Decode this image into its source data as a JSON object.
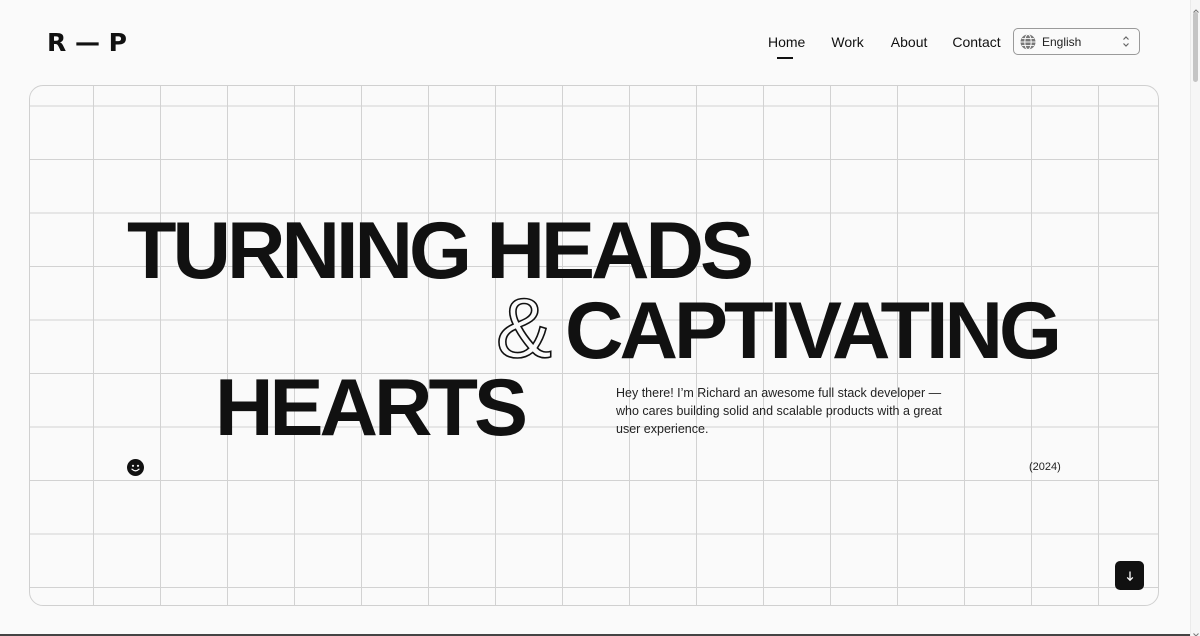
{
  "header": {
    "logo": "R — P",
    "nav": [
      {
        "label": "Home",
        "active": true
      },
      {
        "label": "Work"
      },
      {
        "label": "About"
      },
      {
        "label": "Contact"
      }
    ],
    "language": {
      "selected": "English",
      "icon": "globe-icon"
    }
  },
  "hero": {
    "line1": "TURNING HEADS",
    "ampersand": "&",
    "line2": "CAPTIVATING",
    "line3": "HEARTS",
    "intro": "Hey there! I’m Richard an awesome full stack developer — who cares building solid and scalable products with a great user experience.",
    "year": "(2024)",
    "smiley_icon": "smiley-icon",
    "scroll_icon": "arrow-down-icon"
  },
  "colors": {
    "background": "#fafafa",
    "text": "#111111",
    "grid": "#d2d2d2",
    "button": "#111111"
  }
}
